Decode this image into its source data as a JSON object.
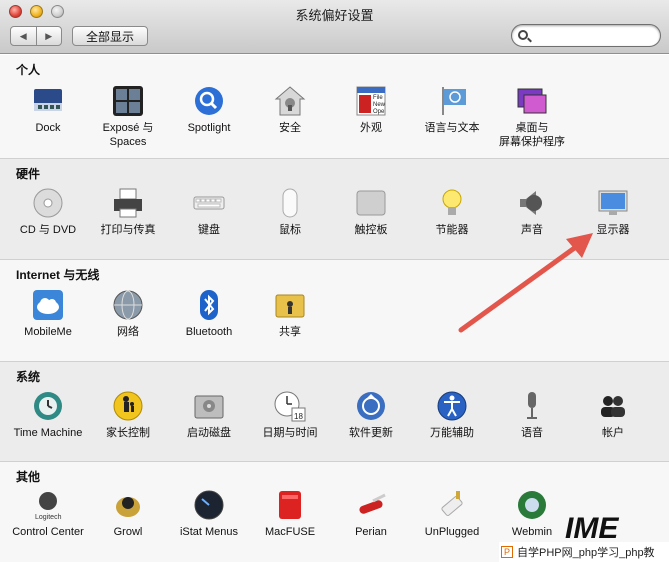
{
  "window": {
    "title": "系统偏好设置"
  },
  "toolbar": {
    "back": "◀",
    "forward": "▶",
    "show_all": "全部显示",
    "search_value": ""
  },
  "sections": [
    {
      "label": "个人",
      "items": [
        {
          "label": "Dock"
        },
        {
          "label": "Exposé 与\nSpaces"
        },
        {
          "label": "Spotlight"
        },
        {
          "label": "安全"
        },
        {
          "label": "外观"
        },
        {
          "label": "语言与文本"
        },
        {
          "label": "桌面与\n屏幕保护程序"
        }
      ]
    },
    {
      "label": "硬件",
      "items": [
        {
          "label": "CD 与 DVD"
        },
        {
          "label": "打印与传真"
        },
        {
          "label": "键盘"
        },
        {
          "label": "鼠标"
        },
        {
          "label": "触控板"
        },
        {
          "label": "节能器"
        },
        {
          "label": "声音"
        },
        {
          "label": "显示器"
        }
      ]
    },
    {
      "label": "Internet 与无线",
      "items": [
        {
          "label": "MobileMe"
        },
        {
          "label": "网络"
        },
        {
          "label": "Bluetooth"
        },
        {
          "label": "共享"
        }
      ]
    },
    {
      "label": "系统",
      "items": [
        {
          "label": "Time Machine"
        },
        {
          "label": "家长控制"
        },
        {
          "label": "启动磁盘"
        },
        {
          "label": "日期与时间"
        },
        {
          "label": "软件更新"
        },
        {
          "label": "万能辅助"
        },
        {
          "label": "语音"
        },
        {
          "label": "帐户"
        }
      ]
    },
    {
      "label": "其他",
      "items": [
        {
          "label": "Control Center"
        },
        {
          "label": "Growl"
        },
        {
          "label": "iStat Menus"
        },
        {
          "label": "MacFUSE"
        },
        {
          "label": "Perian"
        },
        {
          "label": "UnPlugged"
        },
        {
          "label": "Webmin"
        }
      ]
    }
  ],
  "icon_texts": {
    "logitech": "Logitech",
    "date_day": "18",
    "appearance_file": "File",
    "appearance_new": "New",
    "appearance_open": "Ope"
  },
  "watermark": {
    "box": "P",
    "text": "自学PHP网_php学习_php教",
    "logo": "IME"
  },
  "colors": {
    "arrow": "#e2564b"
  }
}
